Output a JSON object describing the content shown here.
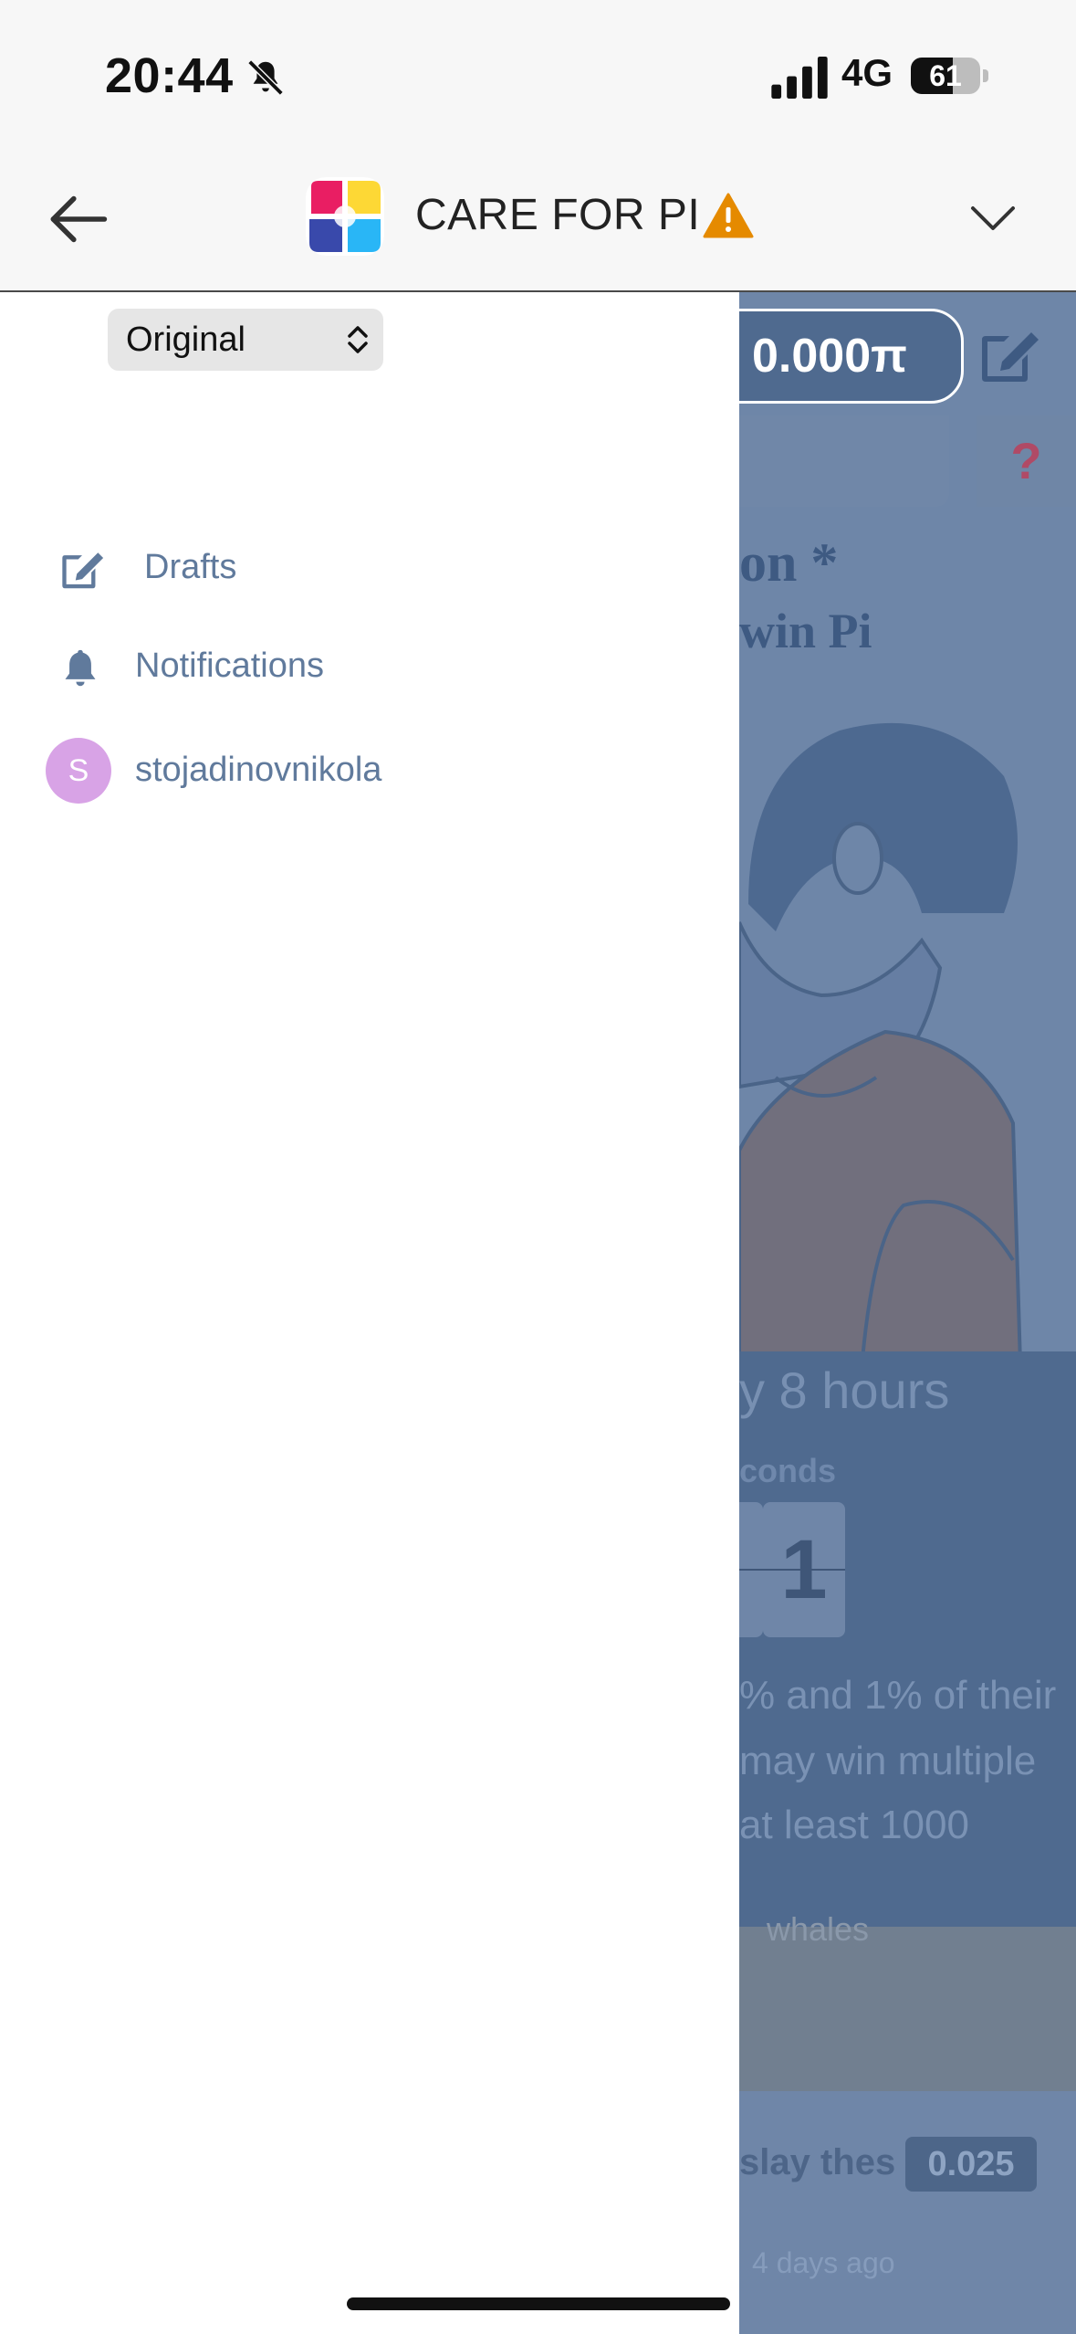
{
  "status_bar": {
    "time": "20:44",
    "network": "4G",
    "battery": "61",
    "icons": [
      "bell-muted-icon",
      "signal-icon",
      "battery-icon"
    ]
  },
  "header": {
    "title": "CARE FOR PI",
    "icons": [
      "back-arrow-icon",
      "app-logo-icon",
      "warning-icon",
      "chevron-down-icon"
    ],
    "accent_warning": "#e58a00"
  },
  "balance": {
    "amount": "0.000π"
  },
  "drawer": {
    "language_select": "Original",
    "items": [
      {
        "label": "Drafts",
        "icon": "edit-icon"
      },
      {
        "label": "Notifications",
        "icon": "bell-icon"
      },
      {
        "label": "stojadinovnikola",
        "icon": "avatar",
        "avatar_letter": "S"
      }
    ],
    "item_color": "#607a9c"
  },
  "background_page": {
    "heading_line1": "on *",
    "heading_line2": "win Pi",
    "hours_text": "y 8 hours",
    "seconds_label": "conds",
    "digit": "1",
    "para_line1": "% and 1% of their",
    "para_line2": "may win multiple",
    "para_line3": "at least 1000",
    "partial_text": "whales",
    "row_text": "slay thes",
    "badge": "0.025",
    "time_ago": "4 days ago",
    "question_mark": "?"
  }
}
